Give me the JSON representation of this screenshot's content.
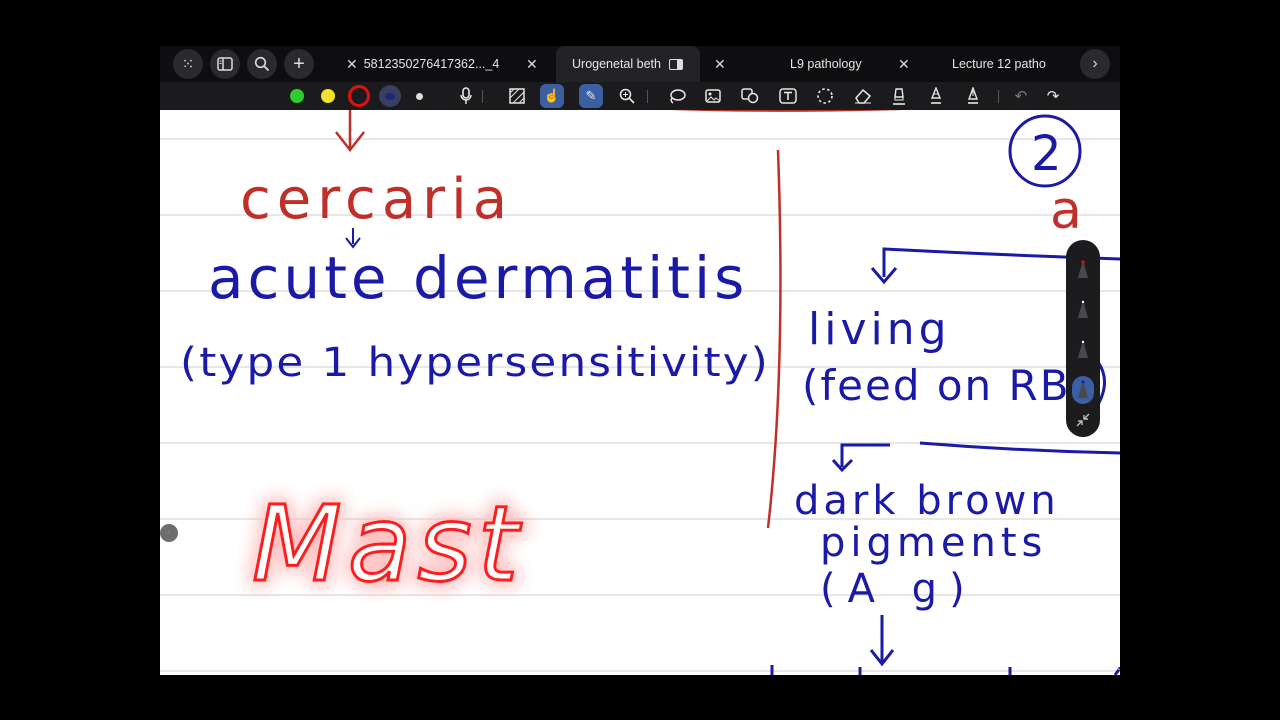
{
  "tabs": [
    {
      "label": "5812350276417362..._4"
    },
    {
      "label": "Urogenetal beth",
      "active": true
    },
    {
      "label": "L9 pathology"
    },
    {
      "label": "Lecture 12 patho"
    }
  ],
  "toolbar": {
    "colors": [
      "#2ecc2e",
      "#f2e22a",
      "#e01010",
      "#2a3a8a",
      "#dddddd"
    ]
  },
  "notes": {
    "cercaria": "cercaria",
    "acute_dermatitis": "acute dermatitis",
    "type1": "(type 1 hypersensitivity)",
    "mast": "Mast",
    "circle_num": "2",
    "a_word": "a",
    "living": "living",
    "feed_on": "(feed on RBC",
    "dark_brown": "dark brown",
    "pigments": "pigments",
    "ag": "(A g)"
  },
  "colors": {
    "ink_blue": "#1a1aa6",
    "ink_red": "#c0302a",
    "ruled_line": "#cfcfcf"
  }
}
